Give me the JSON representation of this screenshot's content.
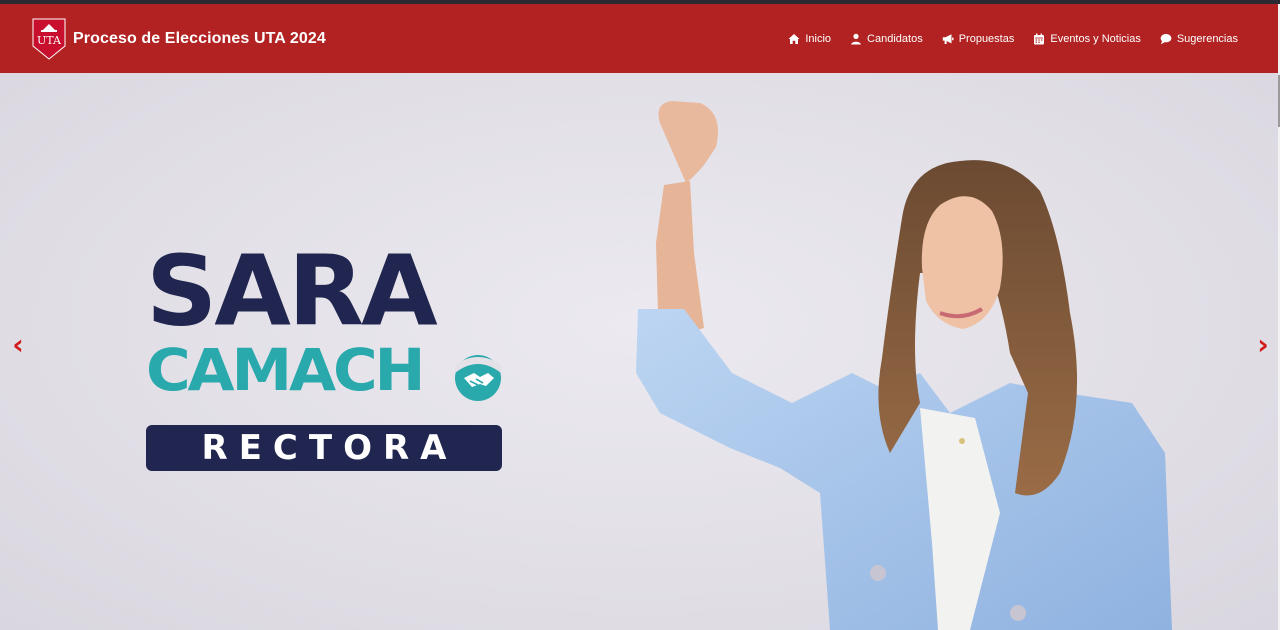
{
  "header": {
    "logo_text": "UTA",
    "title": "Proceso de Elecciones UTA 2024",
    "nav": [
      {
        "label": "Inicio",
        "icon": "home-icon"
      },
      {
        "label": "Candidatos",
        "icon": "user-icon"
      },
      {
        "label": "Propuestas",
        "icon": "megaphone-icon"
      },
      {
        "label": "Eventos y Noticias",
        "icon": "calendar-icon"
      },
      {
        "label": "Sugerencias",
        "icon": "comment-icon"
      }
    ]
  },
  "carousel": {
    "slide": {
      "name_line1": "SARA",
      "name_line2": "CAMACH",
      "banner": "RECTORA"
    },
    "prev_label": "‹",
    "next_label": "›"
  },
  "colors": {
    "navbar": "#b22222",
    "navy": "#20264f",
    "teal": "#2aa9ac",
    "arrow": "#d11a1a",
    "jacket": "#a9c7ec"
  }
}
